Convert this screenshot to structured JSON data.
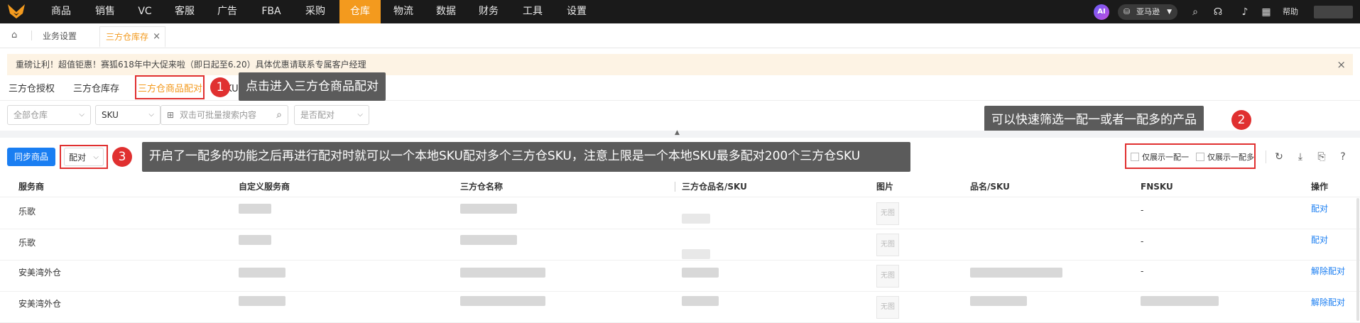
{
  "nav": {
    "items": [
      "商品",
      "销售",
      "VC",
      "客服",
      "广告",
      "FBA",
      "采购",
      "仓库",
      "物流",
      "数据",
      "财务",
      "工具",
      "设置"
    ],
    "active_index": 7,
    "ai_label": "AI",
    "store_label": "亚马逊",
    "help_label": "帮助"
  },
  "tabs": {
    "items": [
      "业务设置",
      "三方仓库存"
    ],
    "active_index": 1,
    "close_glyph": "×"
  },
  "banner": {
    "text": "重磅让利！超值钜惠！赛狐618年中大促来啦（即日起至6.20）具体优惠请联系专属客户经理",
    "close_glyph": "×"
  },
  "subtabs": {
    "items": [
      "三方仓授权",
      "三方仓库存",
      "三方仓商品配对"
    ],
    "active_index": 2,
    "partial_label": "KU"
  },
  "filters": {
    "warehouse_placeholder": "全部仓库",
    "field_select": "SKU",
    "search_placeholder": "双击可批量搜索内容",
    "match_placeholder": "是否配对"
  },
  "toolbar": {
    "sync_button": "同步商品",
    "match_dropdown": "配对",
    "checkbox_one_to_one": "仅展示一配一",
    "checkbox_one_to_many": "仅展示一配多"
  },
  "callouts": {
    "c1": {
      "num": "1",
      "text": "点击进入三方仓商品配对"
    },
    "c2": {
      "num": "2",
      "text": "可以快速筛选一配一或者一配多的产品"
    },
    "c3": {
      "num": "3",
      "text": "开启了一配多的功能之后再进行配对时就可以一个本地SKU配对多个三方仓SKU，注意上限是一个本地SKU最多配对200个三方仓SKU"
    }
  },
  "table": {
    "columns": [
      "服务商",
      "自定义服务商",
      "三方仓名称",
      "三方仓品名/SKU",
      "图片",
      "品名/SKU",
      "FNSKU",
      "操作"
    ],
    "no_image_label": "无图",
    "rows": [
      {
        "provider": "乐歌",
        "fnsku": "-",
        "action": "配对"
      },
      {
        "provider": "乐歌",
        "fnsku": "-",
        "action": "配对"
      },
      {
        "provider": "安美湾外仓",
        "fnsku": "-",
        "action": "解除配对"
      },
      {
        "provider": "安美湾外仓",
        "fnsku": "",
        "action": "解除配对"
      }
    ]
  },
  "colors": {
    "accent": "#f39a1e",
    "primary": "#1a7ef2",
    "highlight": "#e03030",
    "callout_bg": "#5b5b5b"
  }
}
